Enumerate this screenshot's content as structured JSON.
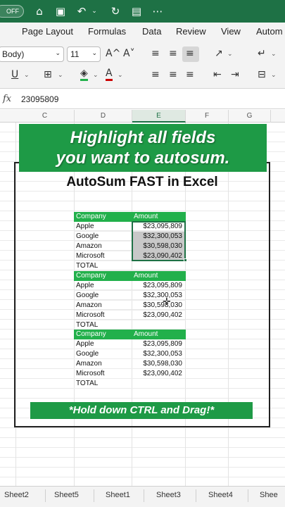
{
  "titlebar": {
    "autosave_label": "OFF"
  },
  "ribbon_tabs": [
    "Page Layout",
    "Formulas",
    "Data",
    "Review",
    "View",
    "Autom"
  ],
  "ribbon": {
    "font_name": "Body)",
    "font_size": "11",
    "grow_font": "A^",
    "shrink_font": "A˅",
    "underline": "U",
    "font_color": "A"
  },
  "formula_bar": {
    "fx": "fx",
    "value": "23095809"
  },
  "columns": [
    "C",
    "D",
    "E",
    "F",
    "G"
  ],
  "banner_top": {
    "line1": "Highlight all fields",
    "line2": "you want to autosum."
  },
  "main_title": "AutoSum FAST in Excel",
  "tables": [
    {
      "header": [
        "Company",
        "Amount"
      ],
      "rows": [
        {
          "company": "Apple",
          "amount": "$23,095,809"
        },
        {
          "company": "Google",
          "amount": "$32,300,053"
        },
        {
          "company": "Amazon",
          "amount": "$30,598,030"
        },
        {
          "company": "Microsoft",
          "amount": "$23,090,402"
        }
      ],
      "total_label": "TOTAL"
    },
    {
      "header": [
        "Company",
        "Amount"
      ],
      "rows": [
        {
          "company": "Apple",
          "amount": "$23,095,809"
        },
        {
          "company": "Google",
          "amount": "$32,300,053"
        },
        {
          "company": "Amazon",
          "amount": "$30,598,030"
        },
        {
          "company": "Microsoft",
          "amount": "$23,090,402"
        }
      ],
      "total_label": "TOTAL"
    },
    {
      "header": [
        "Company",
        "Amount"
      ],
      "rows": [
        {
          "company": "Apple",
          "amount": "$23,095,809"
        },
        {
          "company": "Google",
          "amount": "$32,300,053"
        },
        {
          "company": "Amazon",
          "amount": "$30,598,030"
        },
        {
          "company": "Microsoft",
          "amount": "$23,090,402"
        }
      ],
      "total_label": "TOTAL"
    }
  ],
  "banner_bottom": "*Hold down CTRL and Drag!*",
  "sheet_tabs": [
    "Sheet2",
    "Sheet5",
    "Sheet1",
    "Sheet3",
    "Sheet4",
    "Shee"
  ],
  "colors": {
    "excel_green": "#1e7145",
    "banner_green": "#1e9a46",
    "header_green": "#22b04b",
    "selection_gray": "#c8c8c8"
  }
}
